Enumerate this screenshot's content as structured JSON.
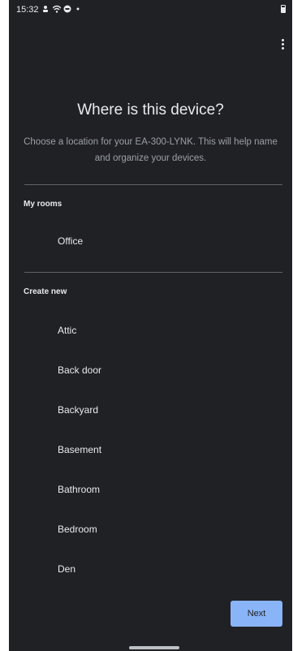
{
  "status_bar": {
    "time": "15:32",
    "icons": [
      "notification-icon",
      "wifi-icon",
      "cast-icon",
      "dot-icon",
      "battery-icon"
    ]
  },
  "header": {
    "title": "Where is this device?",
    "subtitle": "Choose a location for your EA-300-LYNK. This will help name and organize your devices."
  },
  "my_rooms": {
    "label": "My rooms",
    "items": [
      "Office"
    ]
  },
  "create_new": {
    "label": "Create new",
    "items": [
      "Attic",
      "Back door",
      "Backyard",
      "Basement",
      "Bathroom",
      "Bedroom",
      "Den"
    ]
  },
  "footer": {
    "next_label": "Next"
  },
  "colors": {
    "background": "#202124",
    "accent": "#8ab4f8",
    "text": "#e8eaed",
    "secondary_text": "#9aa0a6"
  }
}
